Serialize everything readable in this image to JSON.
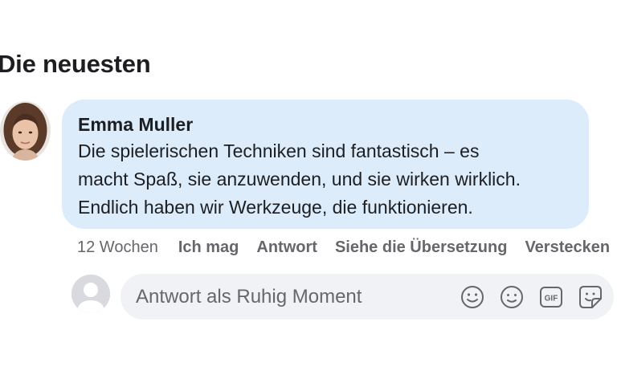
{
  "section": {
    "title": "Die neuesten"
  },
  "comment": {
    "author": "Emma Muller",
    "lines": [
      "Die spielerischen Techniken sind fantastisch – es",
      "macht Spaß, sie anzuwenden, und sie wirken wirklich.",
      "Endlich haben wir Werkzeuge, die funktionieren."
    ],
    "bubble_color": "#dcecfb"
  },
  "actions": {
    "time": "12 Wochen",
    "like": "Ich mag",
    "reply": "Antwort",
    "translate": "Siehe die Übersetzung",
    "hide": "Verstecken"
  },
  "reply_box": {
    "placeholder": "Antwort als Ruhig Moment",
    "icons": [
      "emoji-icon",
      "avatar-sticker-icon",
      "gif-icon",
      "sticker-icon"
    ]
  },
  "colors": {
    "secondary_text": "#65676b",
    "input_bg": "#f0f2f5"
  }
}
